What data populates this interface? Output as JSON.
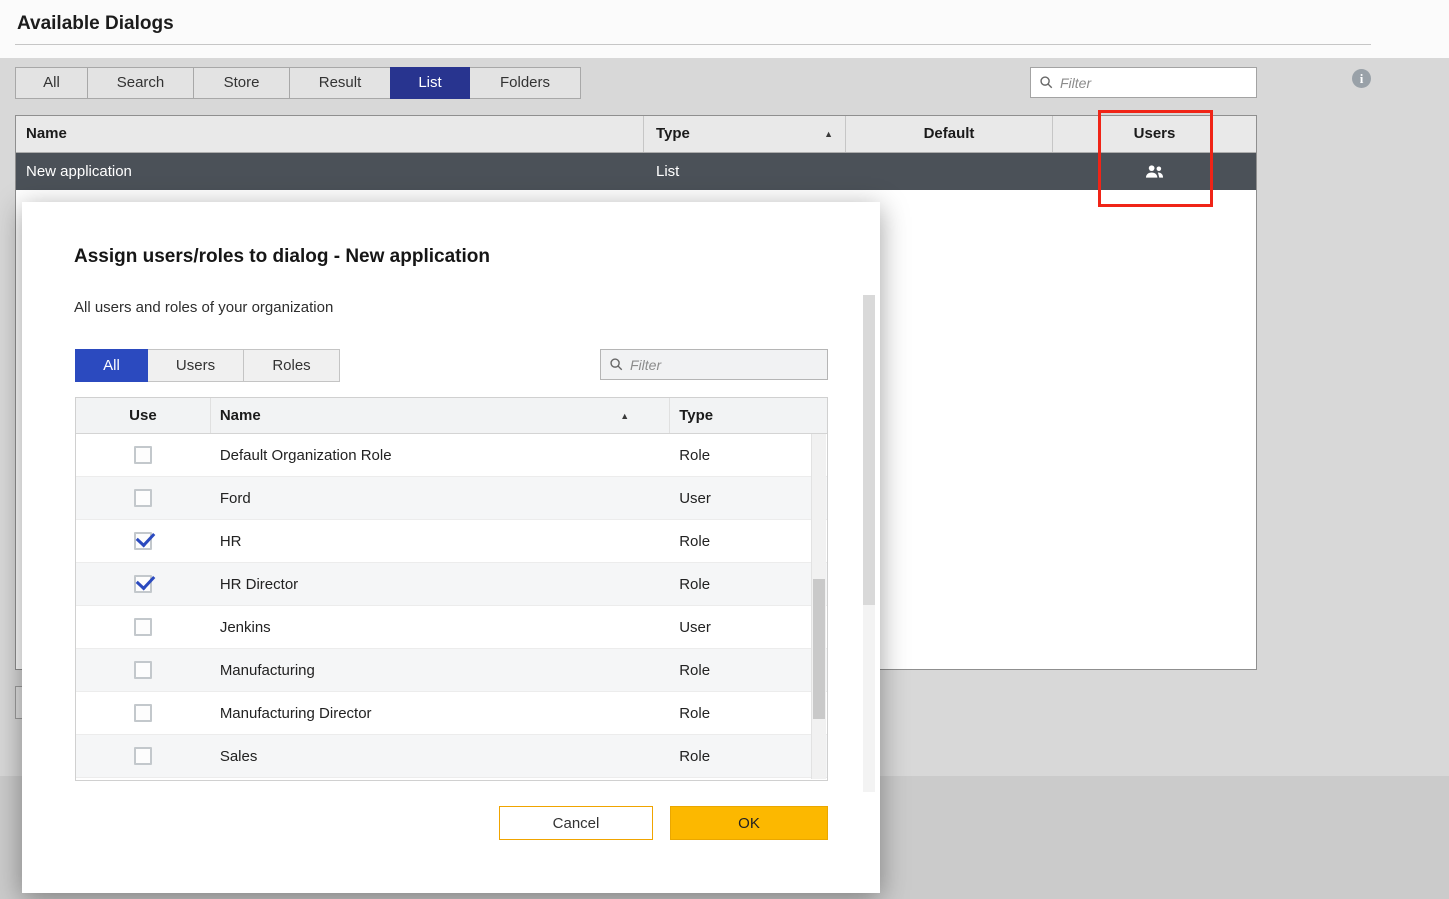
{
  "page": {
    "title": "Available Dialogs",
    "tabs": [
      {
        "label": "All",
        "active": false
      },
      {
        "label": "Search",
        "active": false
      },
      {
        "label": "Store",
        "active": false
      },
      {
        "label": "Result",
        "active": false
      },
      {
        "label": "List",
        "active": true
      },
      {
        "label": "Folders",
        "active": false
      }
    ],
    "filter_placeholder": "Filter",
    "table": {
      "columns": [
        "Name",
        "Type",
        "Default",
        "Users"
      ],
      "sort_column": "Type",
      "sort_direction": "asc",
      "rows": [
        {
          "name": "New application",
          "type": "List",
          "selected": true,
          "has_users_icon": true
        }
      ]
    }
  },
  "modal": {
    "title": "Assign users/roles to dialog - New application",
    "subtitle": "All users and roles of your organization",
    "tabs": [
      {
        "label": "All",
        "active": true
      },
      {
        "label": "Users",
        "active": false
      },
      {
        "label": "Roles",
        "active": false
      }
    ],
    "filter_placeholder": "Filter",
    "table": {
      "columns": [
        "Use",
        "Name",
        "Type"
      ],
      "sort_column": "Name",
      "sort_direction": "asc",
      "rows": [
        {
          "use": false,
          "name": "Default Organization Role",
          "type": "Role"
        },
        {
          "use": false,
          "name": "Ford",
          "type": "User"
        },
        {
          "use": true,
          "name": "HR",
          "type": "Role"
        },
        {
          "use": true,
          "name": "HR Director",
          "type": "Role"
        },
        {
          "use": false,
          "name": "Jenkins",
          "type": "User"
        },
        {
          "use": false,
          "name": "Manufacturing",
          "type": "Role"
        },
        {
          "use": false,
          "name": "Manufacturing Director",
          "type": "Role"
        },
        {
          "use": false,
          "name": "Sales",
          "type": "Role"
        }
      ]
    },
    "buttons": {
      "cancel": "Cancel",
      "ok": "OK"
    }
  },
  "icons": {
    "sort_asc": "▲",
    "info": "i"
  },
  "colors": {
    "nav_selected_blue": "#28348f",
    "modal_selected_blue": "#2b4abf",
    "ok_amber": "#fcb800",
    "highlight_red": "#f02417",
    "selected_row_gray": "#4b5158",
    "check_blue": "#2b4abf"
  }
}
